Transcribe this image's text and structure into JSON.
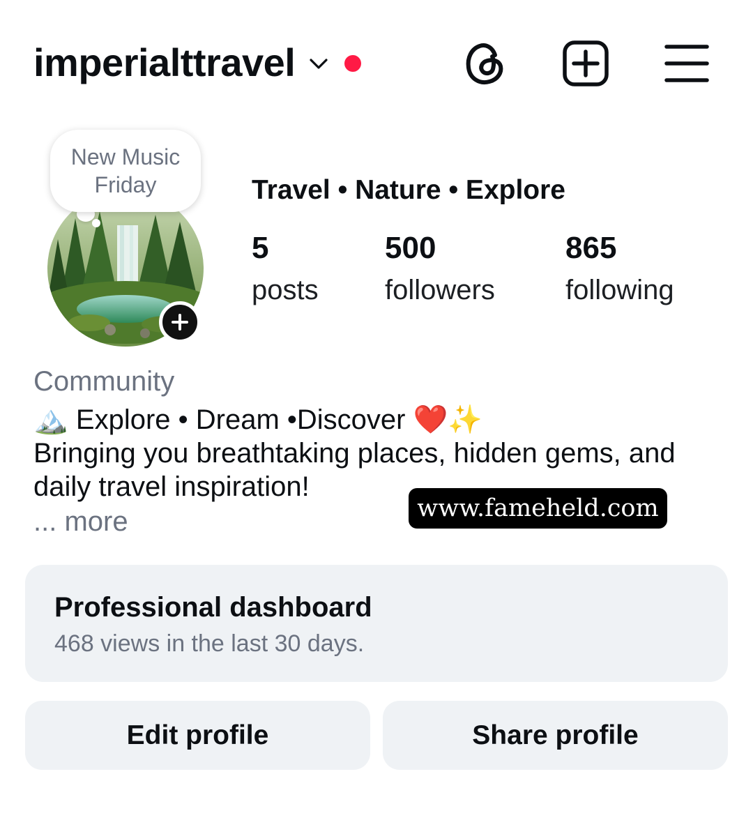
{
  "header": {
    "username": "imperialttravel",
    "notification_dot_color": "#ff1a45",
    "icons": [
      "chevron-down-icon",
      "threads-icon",
      "create-plus-icon",
      "menu-icon"
    ]
  },
  "profile": {
    "note": "New Music Friday",
    "display_name": "Travel • Nature • Explore",
    "stats": [
      {
        "value": "5",
        "label": "posts"
      },
      {
        "value": "500",
        "label": "followers"
      },
      {
        "value": "865",
        "label": "following"
      }
    ],
    "category": "Community",
    "bio_lines": [
      "🏔️ Explore • Dream •Discover ❤️✨",
      "Bringing you breathtaking places, hidden gems, and",
      "daily travel inspiration!"
    ],
    "more": "... more"
  },
  "watermark": "www.fameheld.com",
  "dashboard": {
    "title": "Professional dashboard",
    "subtitle": "468 views in the last 30 days."
  },
  "buttons": {
    "edit": "Edit profile",
    "share": "Share profile"
  }
}
